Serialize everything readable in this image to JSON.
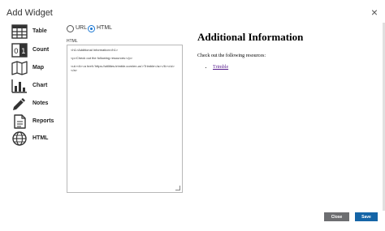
{
  "dialog": {
    "title": "Add Widget",
    "close_symbol": "×"
  },
  "sidebar": {
    "items": [
      {
        "label": "Table",
        "icon": "table-icon"
      },
      {
        "label": "Count",
        "icon": "count-icon"
      },
      {
        "label": "Map",
        "icon": "map-icon"
      },
      {
        "label": "Chart",
        "icon": "chart-icon"
      },
      {
        "label": "Notes",
        "icon": "pencil-icon"
      },
      {
        "label": "Reports",
        "icon": "reports-icon"
      },
      {
        "label": "HTML",
        "icon": "globe-icon"
      }
    ]
  },
  "source": {
    "options": [
      {
        "label": "URL",
        "selected": false
      },
      {
        "label": "HTML",
        "selected": true
      }
    ],
    "field_label": "HTML",
    "editor_lines": [
      "<h1>Additional Information</h1>",
      "",
      "<p>Check out the following resources:</p>",
      "",
      "<ul><li><a href='https://utilities.trimble.com/en-us'>Trimble</a></li></ul>",
      "</a>"
    ]
  },
  "preview": {
    "heading": "Additional Information",
    "paragraph": "Check out the following resources:",
    "link": "Trimble"
  },
  "footer": {
    "close_label": "Close",
    "save_label": "Save"
  },
  "colors": {
    "accent": "#1565a7",
    "secondary_button": "#6d6e71",
    "radio_selected": "#1976d2"
  }
}
